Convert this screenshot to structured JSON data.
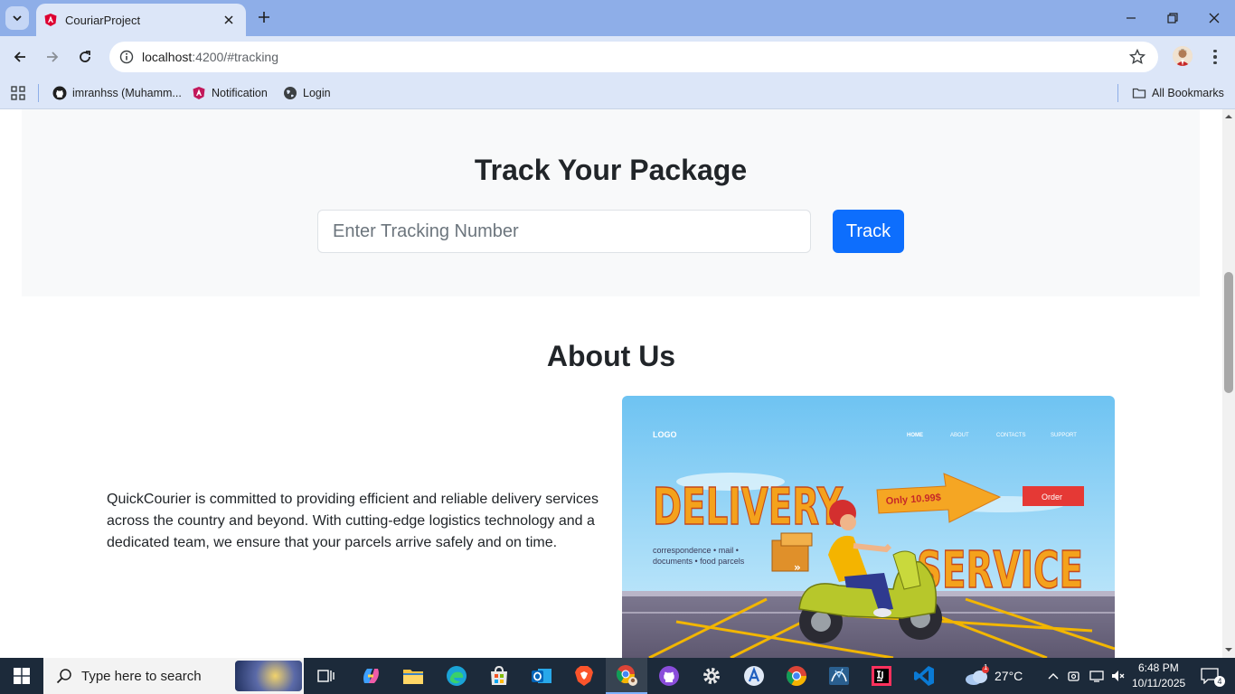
{
  "browser": {
    "tab_title": "CouriarProject",
    "url_host": "localhost",
    "url_path": ":4200/#tracking",
    "bookmarks": [
      {
        "label": "imranhss (Muhamm..."
      },
      {
        "label": "Notification"
      },
      {
        "label": "Login"
      }
    ],
    "all_bookmarks_label": "All Bookmarks"
  },
  "tracking": {
    "title": "Track Your Package",
    "input_placeholder": "Enter Tracking Number",
    "input_value": "",
    "button_label": "Track"
  },
  "about": {
    "title": "About Us",
    "text": "QuickCourier is committed to providing efficient and reliable delivery services across the country and beyond. With cutting-edge logistics technology and a dedicated team, we ensure that your parcels arrive safely and on time.",
    "image": {
      "logo": "LOGO",
      "nav": [
        "HOME",
        "ABOUT",
        "CONTACTS",
        "SUPPORT"
      ],
      "headline_1": "DELIVERY",
      "headline_2": "SERVICE",
      "price_tag": "Only 10.99$",
      "order_button": "Order",
      "tagline_1": "correspondence • mail •",
      "tagline_2": "documents • food parcels"
    }
  },
  "taskbar": {
    "search_placeholder": "Type here to search",
    "weather": "27°C",
    "weather_badge": "1",
    "time": "6:48 PM",
    "date": "10/11/2025",
    "notification_count": "4",
    "colors": {
      "bar": "#1c2a3a",
      "accent": "#0d6efd"
    }
  }
}
